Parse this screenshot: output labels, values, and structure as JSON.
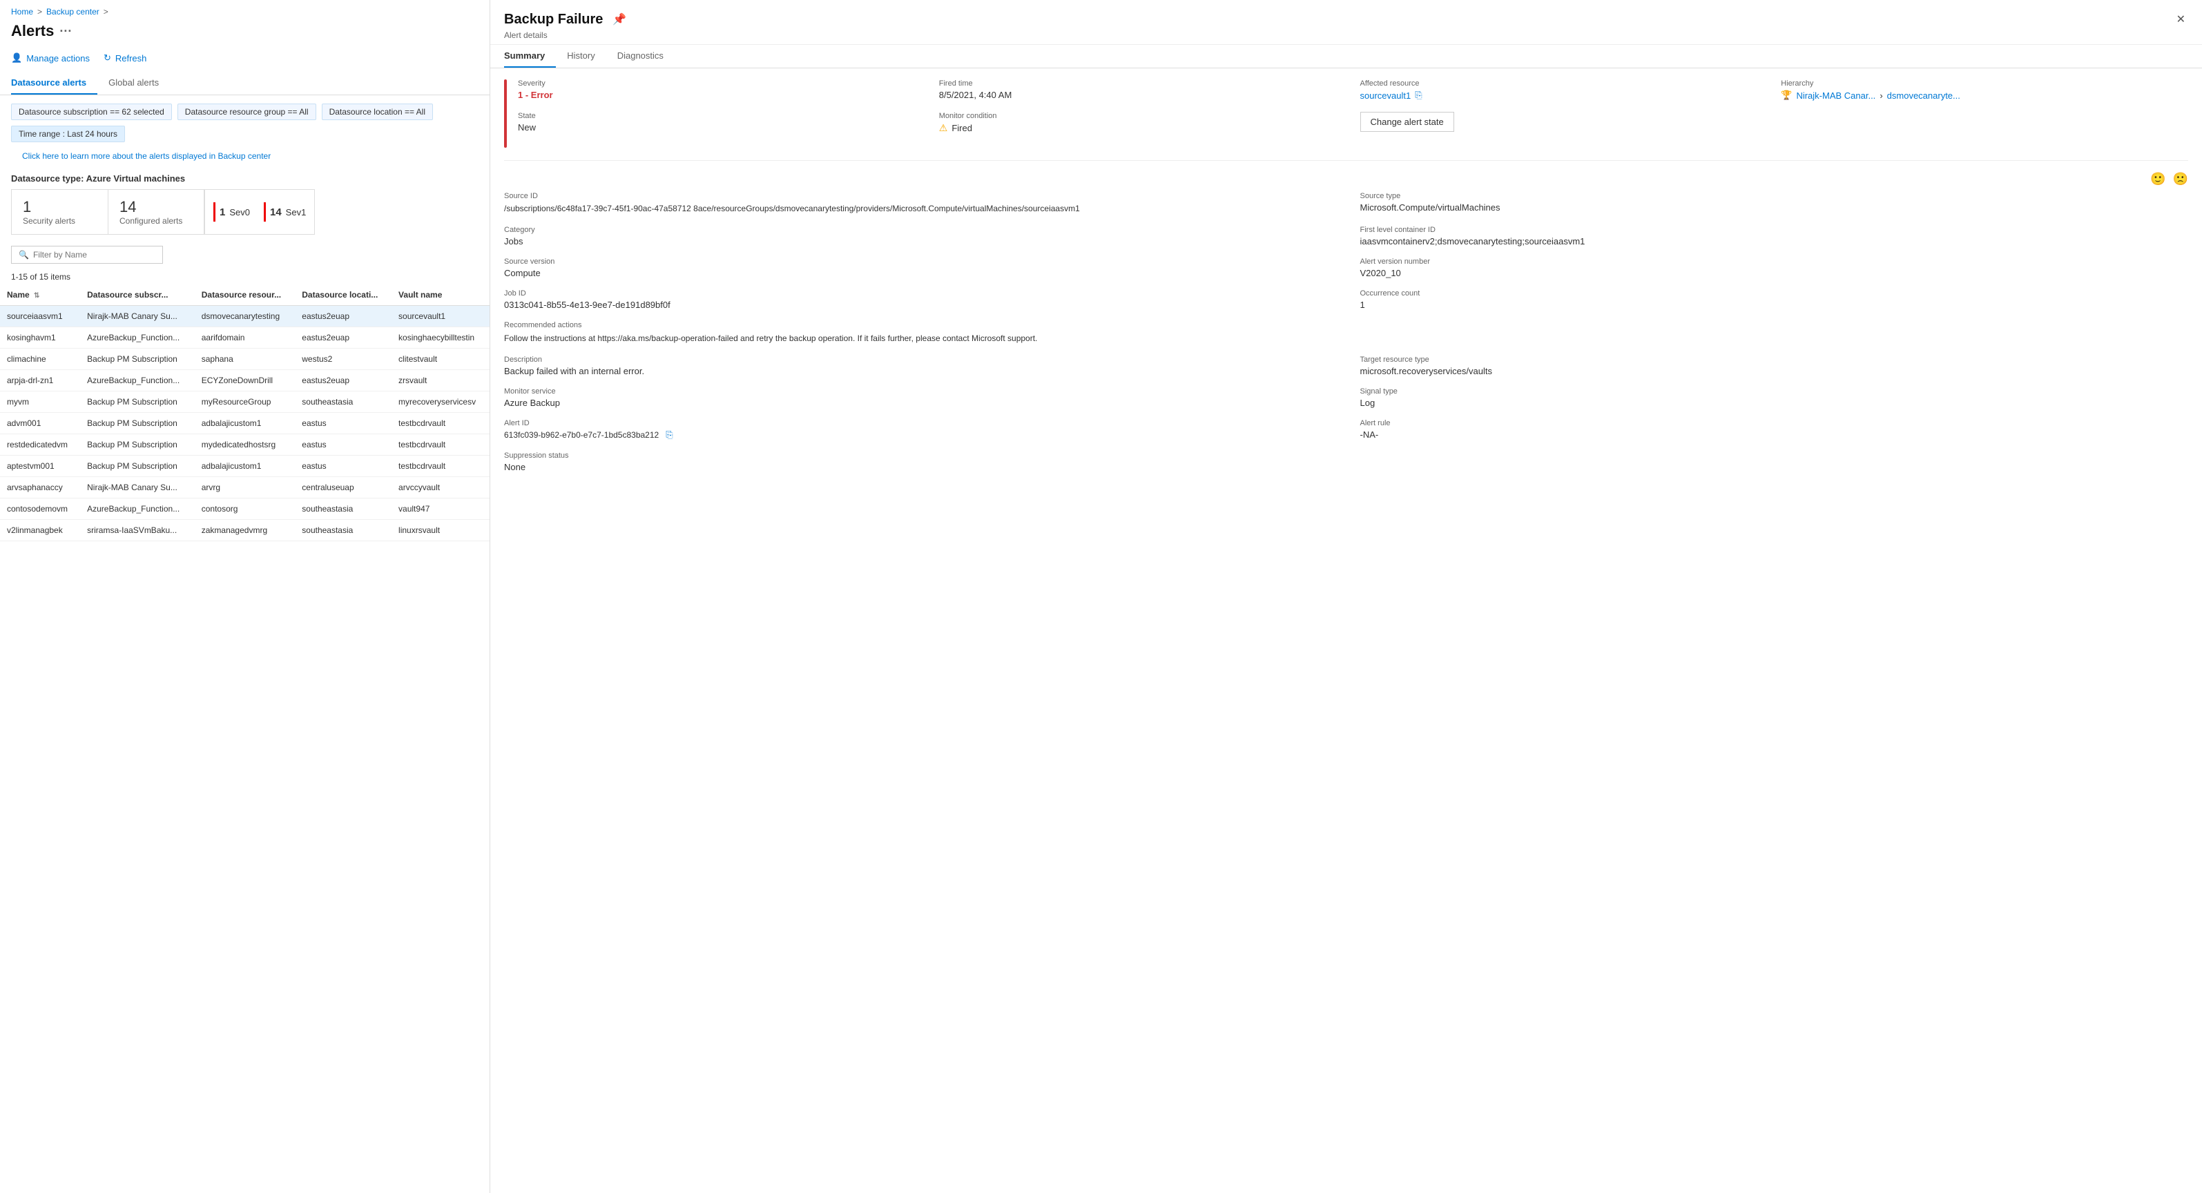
{
  "breadcrumb": {
    "home": "Home",
    "separator1": ">",
    "backupCenter": "Backup center",
    "separator2": ">"
  },
  "pageTitle": "Alerts",
  "pageMenu": "···",
  "toolbar": {
    "manageActions": "Manage actions",
    "refresh": "Refresh"
  },
  "tabs": {
    "datasource": "Datasource alerts",
    "global": "Global alerts"
  },
  "filters": [
    "Datasource subscription == 62 selected",
    "Datasource resource group == All",
    "Datasource location == All",
    "Time range : Last 24 hours"
  ],
  "infoLink": "Click here to learn more about the alerts displayed in Backup center",
  "datasourceType": "Datasource type: Azure Virtual machines",
  "cards": {
    "security": {
      "num": "1",
      "label": "Security alerts"
    },
    "configured": {
      "num": "14",
      "label": "Configured alerts"
    },
    "sev0": {
      "count": "1",
      "label": "Sev0"
    },
    "sev1": {
      "count": "14",
      "label": "Sev1"
    }
  },
  "filterPlaceholder": "Filter by Name",
  "itemsCount": "1-15 of 15 items",
  "tableColumns": [
    "Name",
    "Datasource subscr...",
    "Datasource resour...",
    "Datasource locati...",
    "Vault name"
  ],
  "tableRows": [
    {
      "name": "sourceiaasvm1",
      "subscription": "Nirajk-MAB Canary Su...",
      "resourceGroup": "dsmovecanarytesting",
      "location": "eastus2euap",
      "vault": "sourcevault1",
      "selected": true
    },
    {
      "name": "kosinghavm1",
      "subscription": "AzureBackup_Function...",
      "resourceGroup": "aarifdomain",
      "location": "eastus2euap",
      "vault": "kosinghaecybilltestin",
      "selected": false
    },
    {
      "name": "climachine",
      "subscription": "Backup PM Subscription",
      "resourceGroup": "saphana",
      "location": "westus2",
      "vault": "clitestvault",
      "selected": false
    },
    {
      "name": "arpja-drl-zn1",
      "subscription": "AzureBackup_Function...",
      "resourceGroup": "ECYZoneDownDrill",
      "location": "eastus2euap",
      "vault": "zrsvault",
      "selected": false
    },
    {
      "name": "myvm",
      "subscription": "Backup PM Subscription",
      "resourceGroup": "myResourceGroup",
      "location": "southeastasia",
      "vault": "myrecoveryservicesv",
      "selected": false
    },
    {
      "name": "advm001",
      "subscription": "Backup PM Subscription",
      "resourceGroup": "adbalajicustom1",
      "location": "eastus",
      "vault": "testbcdrvault",
      "selected": false
    },
    {
      "name": "restdedicatedvm",
      "subscription": "Backup PM Subscription",
      "resourceGroup": "mydedicatedhostsrg",
      "location": "eastus",
      "vault": "testbcdrvault",
      "selected": false
    },
    {
      "name": "aptestvm001",
      "subscription": "Backup PM Subscription",
      "resourceGroup": "adbalajicustom1",
      "location": "eastus",
      "vault": "testbcdrvault",
      "selected": false
    },
    {
      "name": "arvsaphanaccy",
      "subscription": "Nirajk-MAB Canary Su...",
      "resourceGroup": "arvrg",
      "location": "centraluseuap",
      "vault": "arvccyvault",
      "selected": false
    },
    {
      "name": "contosodemovm",
      "subscription": "AzureBackup_Function...",
      "resourceGroup": "contosorg",
      "location": "southeastasia",
      "vault": "vault947",
      "selected": false
    },
    {
      "name": "v2linmanagbek",
      "subscription": "sriramsa-IaaSVmBaku...",
      "resourceGroup": "zakmanagedvmrg",
      "location": "southeastasia",
      "vault": "linuxrsvault",
      "selected": false
    }
  ],
  "rightPanel": {
    "title": "Backup Failure",
    "subtitle": "Alert details",
    "tabs": [
      "Summary",
      "History",
      "Diagnostics"
    ],
    "summary": {
      "severityLabel": "Severity",
      "severityValue": "1 - Error",
      "firedTimeLabel": "Fired time",
      "firedTimeValue": "8/5/2021, 4:40 AM",
      "affectedResourceLabel": "Affected resource",
      "affectedResourceValue": "sourcevault1",
      "hierarchyLabel": "Hierarchy",
      "hierarchyItem1": "Nirajk-MAB Canar...",
      "hierarchyItem2": "dsmovecanaryte...",
      "stateLabel": "State",
      "stateValue": "New",
      "monitorConditionLabel": "Monitor condition",
      "monitorConditionValue": "Fired",
      "changeStateBtn": "Change alert state",
      "sourceIdLabel": "Source ID",
      "sourceIdValue": "/subscriptions/6c48fa17-39c7-45f1-90ac-47a58712 8ace/resourceGroups/dsmovecanarytesting/providers/Microsoft.Compute/virtualMachines/sourceiaasvm1",
      "sourceTypeLabel": "Source type",
      "sourceTypeValue": "Microsoft.Compute/virtualMachines",
      "categoryLabel": "Category",
      "categoryValue": "Jobs",
      "firstLevelContainerLabel": "First level container ID",
      "firstLevelContainerValue": "iaasvmcontainerv2;dsmovecanarytesting;sourceiaasvm1",
      "sourceVersionLabel": "Source version",
      "sourceVersionValue": "Compute",
      "alertVersionLabel": "Alert version number",
      "alertVersionValue": "V2020_10",
      "jobIdLabel": "Job ID",
      "jobIdValue": "0313c041-8b55-4e13-9ee7-de191d89bf0f",
      "occurrenceLabel": "Occurrence count",
      "occurrenceValue": "1",
      "recommendedActionsLabel": "Recommended actions",
      "recommendedActionsText": "Follow the instructions at https://aka.ms/backup-operation-failed and retry the backup operation. If it fails further, please contact Microsoft support.",
      "descriptionLabel": "Description",
      "descriptionValue": "Backup failed with an internal error.",
      "targetResourceTypeLabel": "Target resource type",
      "targetResourceTypeValue": "microsoft.recoveryservices/vaults",
      "monitorServiceLabel": "Monitor service",
      "monitorServiceValue": "Azure Backup",
      "signalTypeLabel": "Signal type",
      "signalTypeValue": "Log",
      "alertIdLabel": "Alert ID",
      "alertIdValue": "613fc039-b962-e7b0-e7c7-1bd5c83ba212",
      "alertRuleLabel": "Alert rule",
      "alertRuleValue": "-NA-",
      "suppressionStatusLabel": "Suppression status",
      "suppressionStatusValue": "None"
    }
  }
}
